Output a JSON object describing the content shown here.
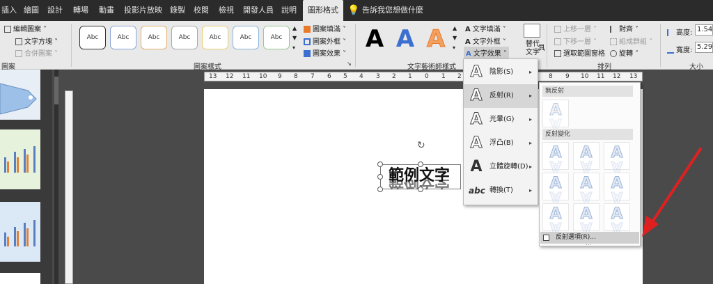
{
  "tabs": [
    "插入",
    "繪圖",
    "設計",
    "轉場",
    "動畫",
    "投影片放映",
    "錄製",
    "校閱",
    "檢視",
    "開發人員",
    "說明",
    "圖形格式"
  ],
  "tell_me": "告訴我您想做什麼",
  "ribbon": {
    "insert_shapes": {
      "edit_shape": "編輯圖案",
      "text_box": "文字方塊",
      "merge_shapes": "合併圖案",
      "group_label": "圖案"
    },
    "shape_styles": {
      "style_label": "Abc",
      "fill": "圖案填滿",
      "outline": "圖案外框",
      "effects": "圖案效果",
      "group_label": "圖案樣式"
    },
    "wordart": {
      "text_fill": "文字填滿",
      "text_outline": "文字外框",
      "text_effects": "文字效果",
      "group_label": "文字藝術師樣式"
    },
    "alt_text": "替代文字",
    "arrange": {
      "bring_forward": "上移一層",
      "send_backward": "下移一層",
      "selection_pane": "選取範圍窗格",
      "align": "對齊",
      "group": "組成群組",
      "rotate": "旋轉",
      "group_label": "排列"
    },
    "size": {
      "height_label": "高度:",
      "height_value": "1.54 公",
      "width_label": "寬度:",
      "width_value": "5.29 公",
      "group_label": "大小"
    },
    "partial_label": "具"
  },
  "ruler_numbers": [
    "13",
    "12",
    "11",
    "10",
    "9",
    "8",
    "7",
    "6",
    "5",
    "4",
    "3",
    "2",
    "1",
    "0",
    "1",
    "2",
    "3",
    "4",
    "5",
    "6",
    "7",
    "8",
    "9",
    "10",
    "11",
    "12",
    "13"
  ],
  "slide": {
    "sample_text": "範例文字"
  },
  "text_effects_menu": [
    {
      "label": "陰影(S)",
      "icon": "shadow-icon"
    },
    {
      "label": "反射(R)",
      "icon": "reflection-icon"
    },
    {
      "label": "光暈(G)",
      "icon": "glow-icon"
    },
    {
      "label": "浮凸(B)",
      "icon": "bevel-icon"
    },
    {
      "label": "立體旋轉(D)",
      "icon": "3d-rotation-icon"
    },
    {
      "label": "轉換(T)",
      "icon": "transform-icon",
      "glyph": "abc"
    }
  ],
  "reflection_submenu": {
    "no_reflection": "無反射",
    "variations": "反射變化",
    "options": "反射選項(R)..."
  },
  "colors": {
    "red_arrow": "#e02020",
    "accent_blue": "#3b6fd0",
    "accent_orange": "#e87a2a"
  }
}
